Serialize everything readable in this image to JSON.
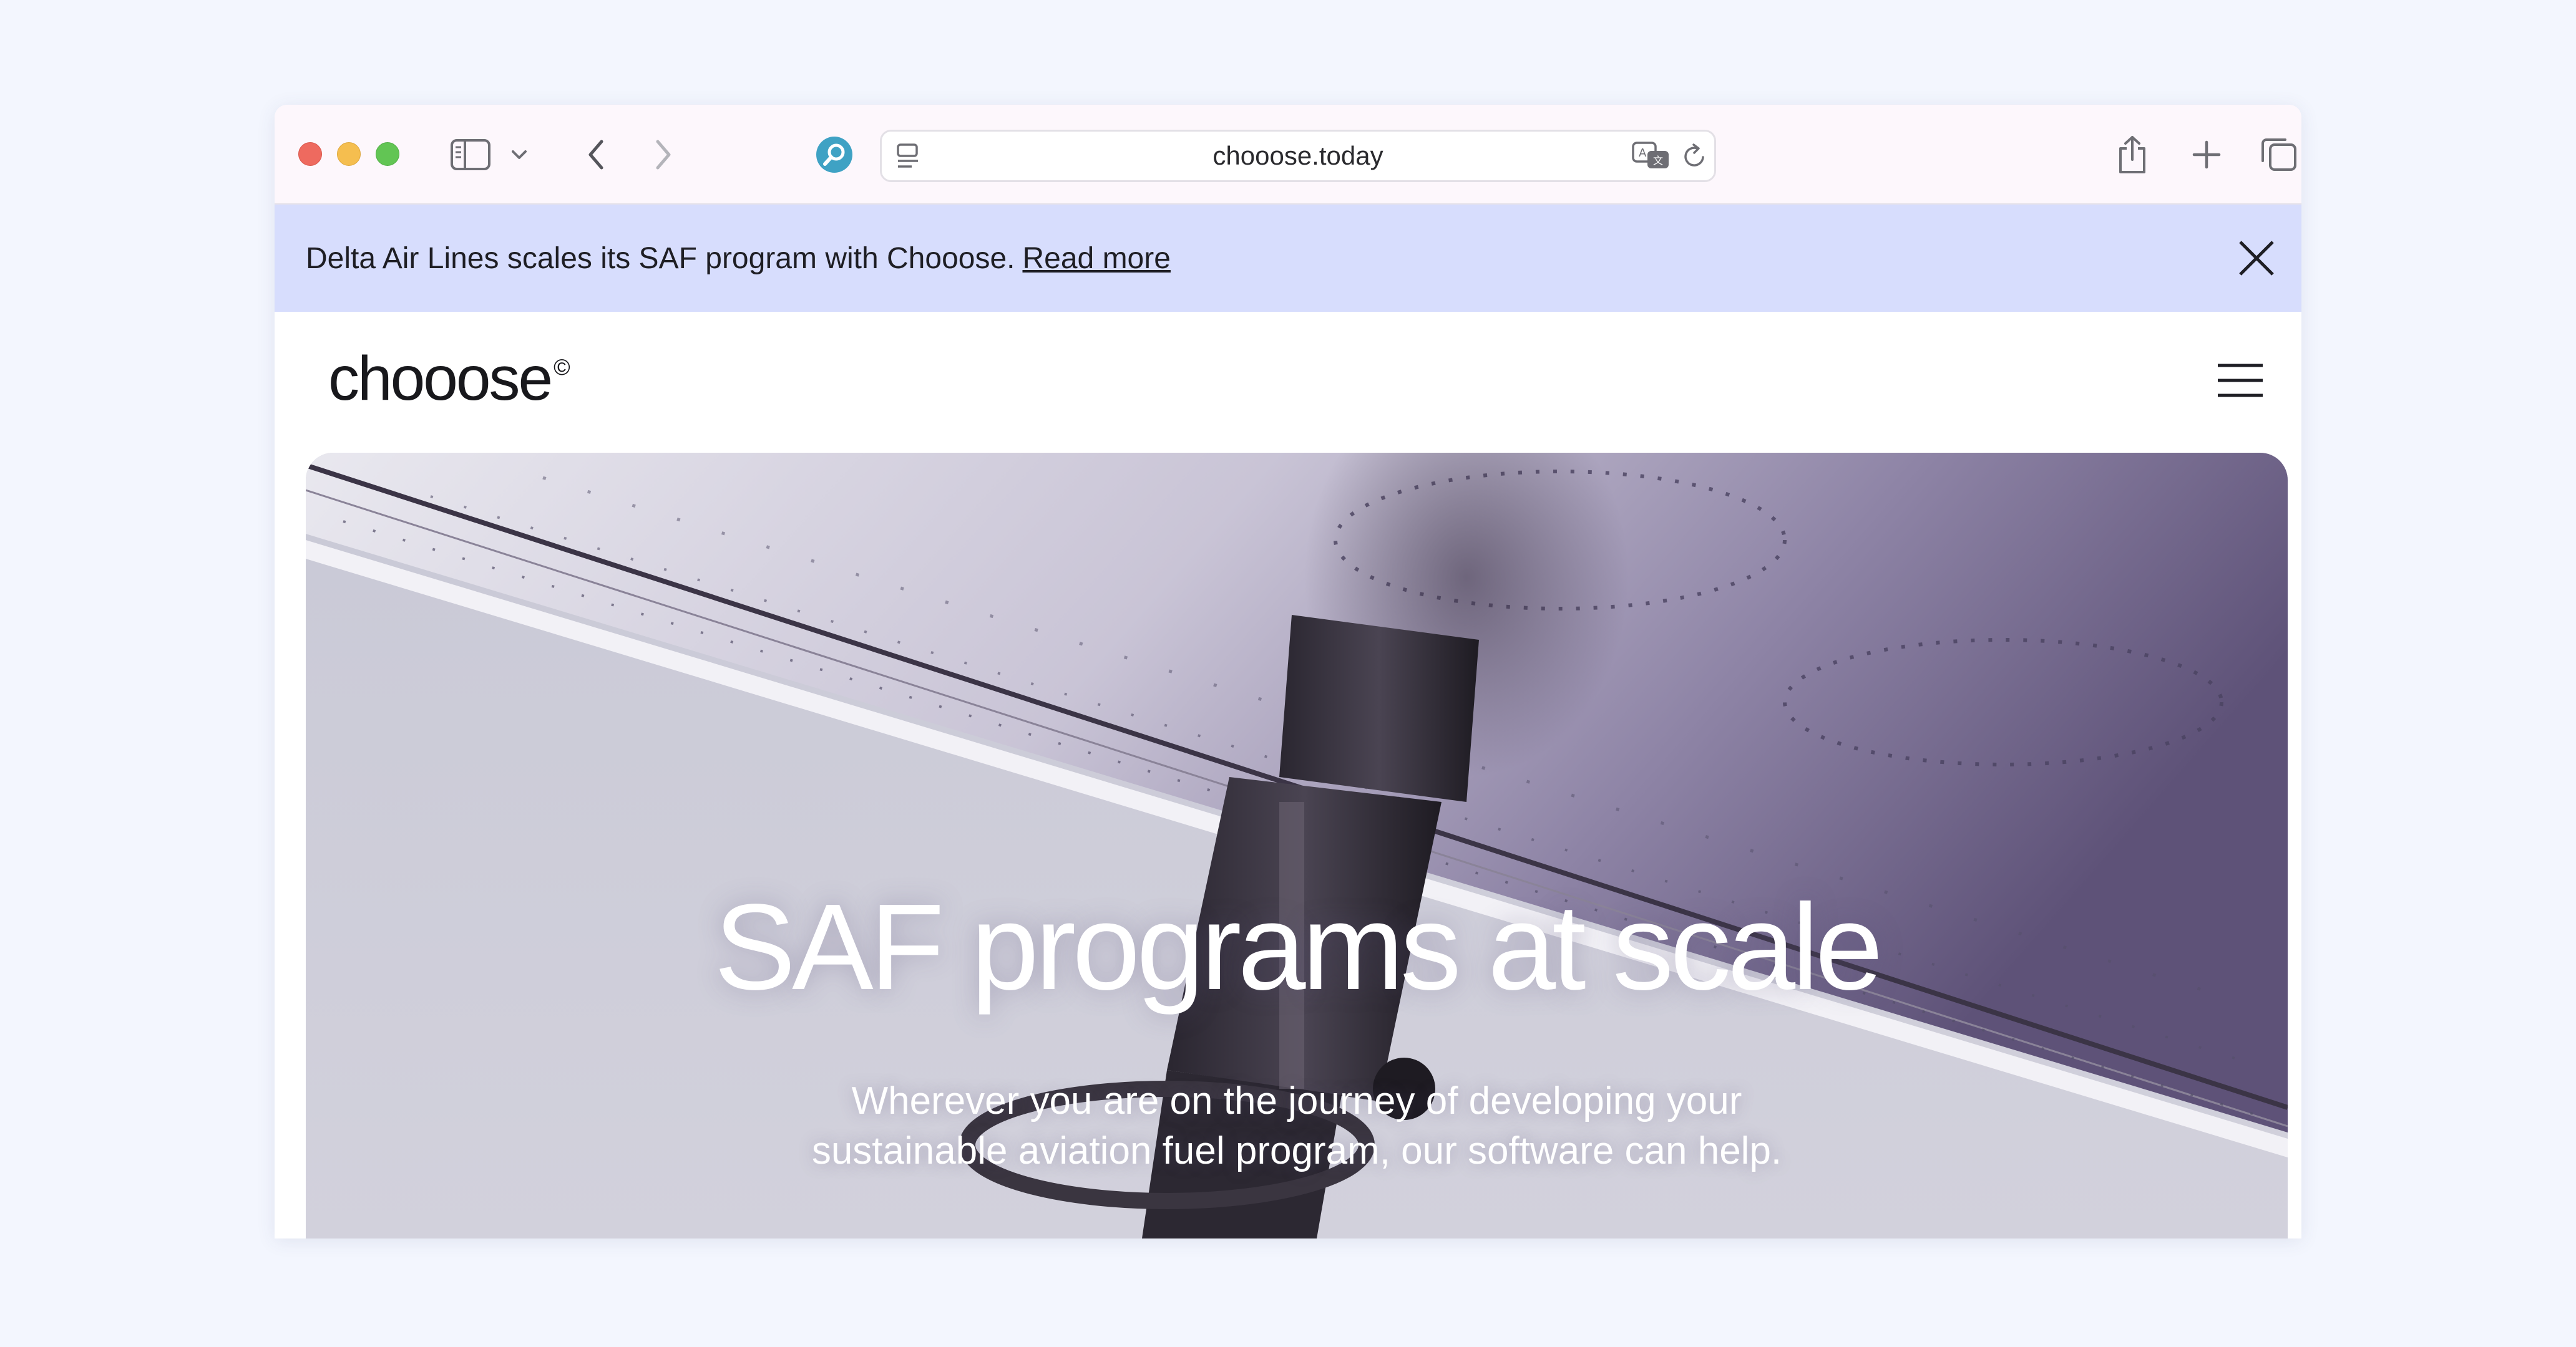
{
  "browser": {
    "url": "chooose.today",
    "icons": [
      "sidebar-icon",
      "chevron-down-icon",
      "back-icon",
      "forward-icon",
      "search-extension-icon",
      "page-menu-icon",
      "translate-icon",
      "reload-icon",
      "share-icon",
      "new-tab-icon",
      "tabs-overview-icon"
    ]
  },
  "banner": {
    "text": "Delta Air Lines scales its SAF program with Chooose.",
    "link": "Read more"
  },
  "header": {
    "logo": "chooose",
    "logo_mark": "©"
  },
  "hero": {
    "title": "SAF programs at scale",
    "subtitle_line1": "Wherever you are on the journey of developing your",
    "subtitle_line2": "sustainable aviation fuel program, our software can help."
  }
}
